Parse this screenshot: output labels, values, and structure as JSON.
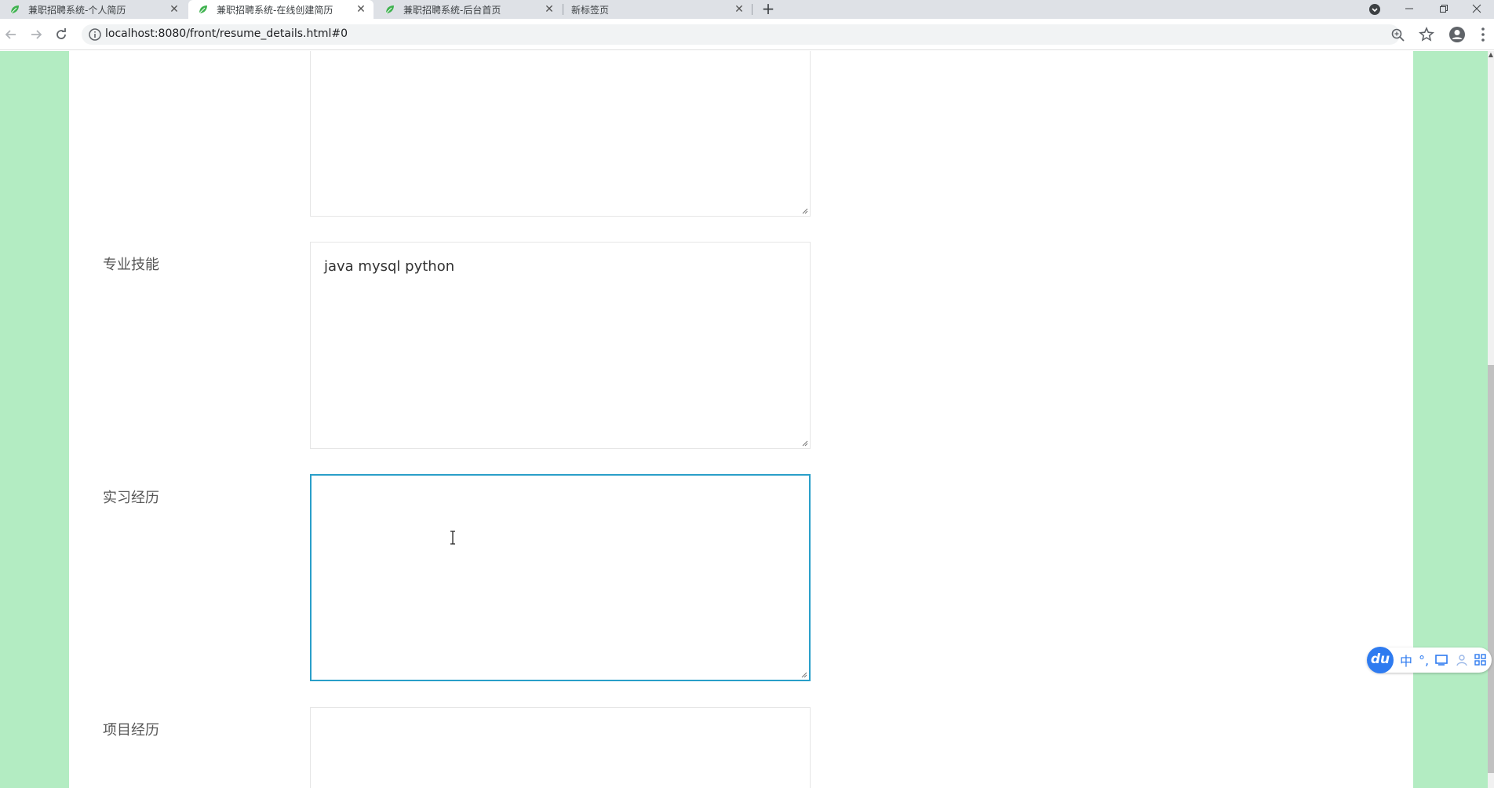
{
  "browser": {
    "tabs": [
      {
        "title": "兼职招聘系统-个人简历",
        "active": false,
        "has_icon": true
      },
      {
        "title": "兼职招聘系统-在线创建简历",
        "active": true,
        "has_icon": true
      },
      {
        "title": "兼职招聘系统-后台首页",
        "active": false,
        "has_icon": true
      },
      {
        "title": "新标签页",
        "active": false,
        "has_icon": false
      }
    ],
    "close_glyph": "✕",
    "new_tab_glyph": "+",
    "url": "localhost:8080/front/resume_details.html#0"
  },
  "form": {
    "fields": [
      {
        "label": "",
        "value": ""
      },
      {
        "label": "专业技能",
        "value": "java  mysql  python"
      },
      {
        "label": "实习经历",
        "value": ""
      },
      {
        "label": "项目经历",
        "value": ""
      }
    ]
  },
  "ime": {
    "logo": "du",
    "items": [
      "中",
      "°,"
    ]
  },
  "colors": {
    "page_bg": "#b3ecc2",
    "focus_border": "#2a9fc9",
    "label": "#555555"
  }
}
